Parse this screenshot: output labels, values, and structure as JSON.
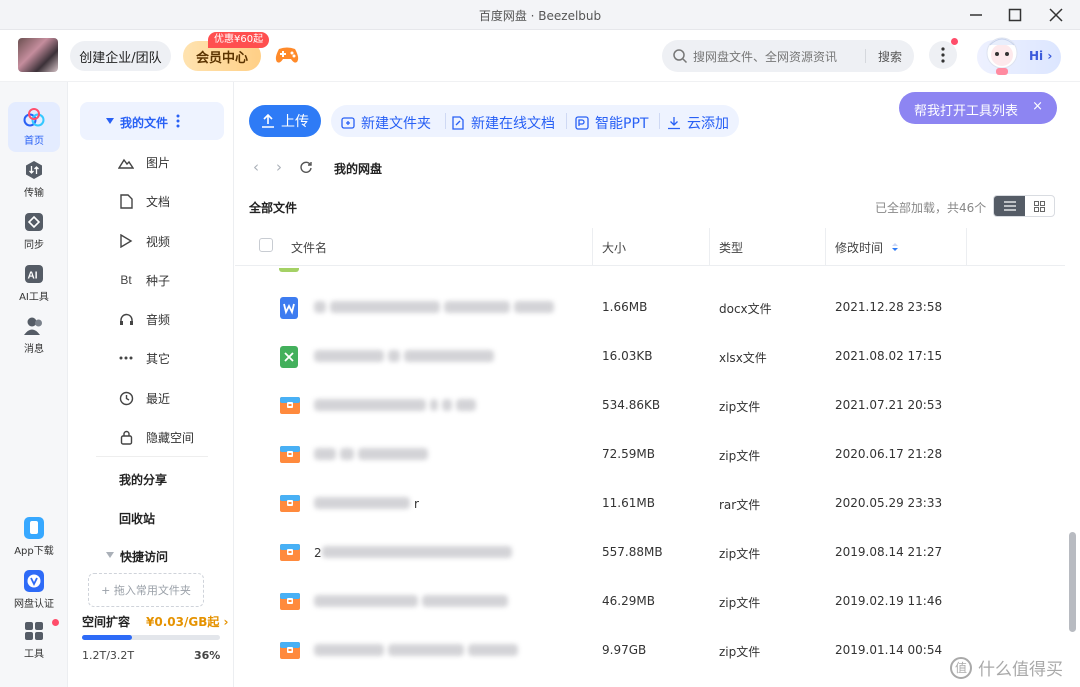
{
  "window": {
    "title": "百度网盘 · Beezelbub"
  },
  "header": {
    "enterprise_label": "创建企业/团队",
    "vip_label": "会员中心",
    "promo_badge": "优惠¥60起",
    "search_placeholder": "搜网盘文件、全网资源资讯",
    "search_button": "搜索",
    "hi_label": "Hi ›"
  },
  "rail": {
    "home": "首页",
    "transfer": "传输",
    "sync": "同步",
    "ai_tools": "AI工具",
    "messages": "消息",
    "app_download": "App下载",
    "verify": "网盘认证",
    "tools": "工具"
  },
  "nav": {
    "my_files": "我的文件",
    "items": [
      "图片",
      "文档",
      "视频",
      "种子",
      "音频",
      "其它",
      "最近",
      "隐藏空间"
    ],
    "my_share": "我的分享",
    "recycle": "回收站",
    "quick_access": "快捷访问",
    "drag_hint": "+ 拖入常用文件夹",
    "quota_title": "空间扩容",
    "quota_price": "¥0.03/GB起 ›",
    "quota_used": "1.2T/3.2T",
    "quota_percent": "36%",
    "quota_fraction": 0.36
  },
  "toolbar": {
    "upload": "上传",
    "new_folder": "新建文件夹",
    "new_doc": "新建在线文档",
    "smart_ppt": "智能PPT",
    "cloud_add": "云添加",
    "help": "帮我打开工具列表",
    "help_close": "×"
  },
  "breadcrumb": {
    "current": "我的网盘"
  },
  "list": {
    "title": "全部文件",
    "loaded": "已全部加载，共46个",
    "columns": {
      "name": "文件名",
      "size": "大小",
      "type": "类型",
      "modified": "修改时间"
    },
    "rows": [
      {
        "icon": "word",
        "size": "1.66MB",
        "type": "docx文件",
        "modified": "2021.12.28 23:58"
      },
      {
        "icon": "excel",
        "size": "16.03KB",
        "type": "xlsx文件",
        "modified": "2021.08.02 17:15"
      },
      {
        "icon": "archive",
        "size": "534.86KB",
        "type": "zip文件",
        "modified": "2021.07.21 20:53"
      },
      {
        "icon": "archive",
        "size": "72.59MB",
        "type": "zip文件",
        "modified": "2020.06.17 21:28"
      },
      {
        "icon": "archive",
        "name_suffix": "r",
        "size": "11.61MB",
        "type": "rar文件",
        "modified": "2020.05.29 23:33"
      },
      {
        "icon": "archive",
        "name_prefix": "2",
        "size": "557.88MB",
        "type": "zip文件",
        "modified": "2019.08.14 21:27"
      },
      {
        "icon": "archive",
        "size": "46.29MB",
        "type": "zip文件",
        "modified": "2019.02.19 11:46"
      },
      {
        "icon": "archive",
        "size": "9.97GB",
        "type": "zip文件",
        "modified": "2019.01.14 00:54"
      }
    ]
  },
  "watermark": "值 什么值得买",
  "colors": {
    "accent": "#2e7bf6",
    "help_pill": "#8d85f2",
    "vip": "#ffcf86"
  }
}
